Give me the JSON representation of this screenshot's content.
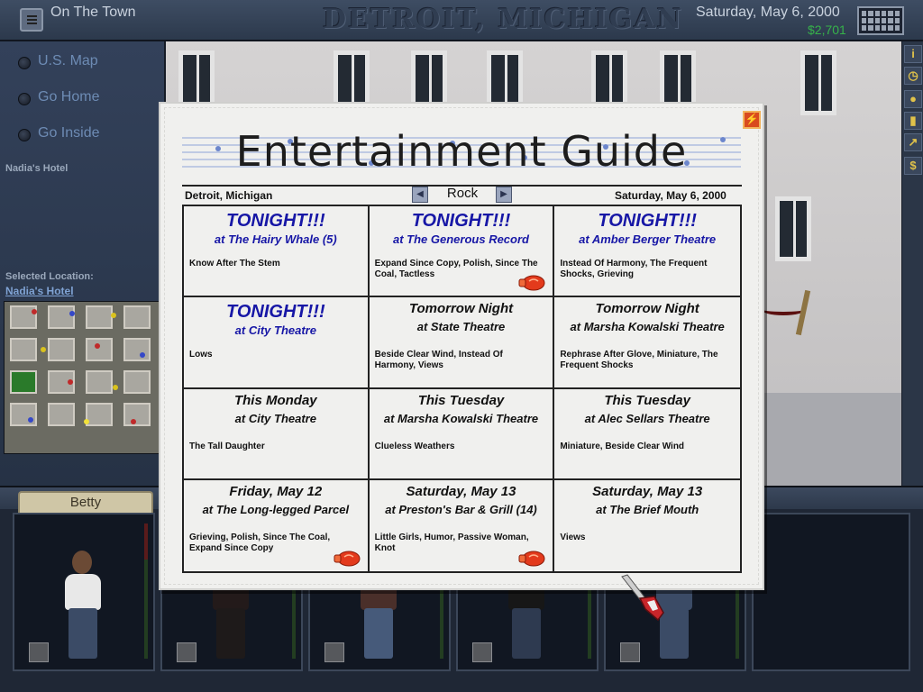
{
  "topbar": {
    "screen_title": "On The Town",
    "city_title": "DETROIT, MICHIGAN",
    "date": "Saturday, May 6, 2000",
    "money": "$2,701"
  },
  "leftnav": {
    "items": [
      {
        "label": "U.S. Map"
      },
      {
        "label": "Go Home"
      },
      {
        "label": "Go Inside"
      }
    ],
    "current_location": "Nadia's Hotel",
    "selected_location_label": "Selected Location:",
    "selected_location": "Nadia's Hotel"
  },
  "band": {
    "member_tab": "Betty"
  },
  "guide": {
    "title": "Entertainment Guide",
    "city": "Detroit, Michigan",
    "genre": "Rock",
    "date": "Saturday, May 6, 2000",
    "close_icon": "close-icon",
    "events": [
      {
        "when": "TONIGHT!!!",
        "where": "at The Hairy Whale (5)",
        "bands": "Know After The Stem",
        "tonight": true,
        "glove": false
      },
      {
        "when": "TONIGHT!!!",
        "where": "at The Generous Record",
        "bands": "Expand Since Copy, Polish, Since The Coal, Tactless",
        "tonight": true,
        "glove": true
      },
      {
        "when": "TONIGHT!!!",
        "where": "at Amber Berger Theatre",
        "bands": "Instead Of Harmony, The Frequent Shocks, Grieving",
        "tonight": true,
        "glove": false
      },
      {
        "when": "TONIGHT!!!",
        "where": "at City Theatre",
        "bands": "Lows",
        "tonight": true,
        "glove": false
      },
      {
        "when": "Tomorrow Night",
        "where": "at State Theatre",
        "bands": "Beside Clear Wind, Instead Of Harmony, Views",
        "tonight": false,
        "glove": false
      },
      {
        "when": "Tomorrow Night",
        "where": "at Marsha Kowalski Theatre",
        "bands": "Rephrase After Glove, Miniature, The Frequent Shocks",
        "tonight": false,
        "glove": false
      },
      {
        "when": "This Monday",
        "where": "at City Theatre",
        "bands": "The Tall Daughter",
        "tonight": false,
        "glove": false
      },
      {
        "when": "This Tuesday",
        "where": "at Marsha Kowalski Theatre",
        "bands": "Clueless Weathers",
        "tonight": false,
        "glove": false
      },
      {
        "when": "This Tuesday",
        "where": "at Alec Sellars Theatre",
        "bands": "Miniature, Beside Clear Wind",
        "tonight": false,
        "glove": false
      },
      {
        "when": "Friday, May 12",
        "where": "at The Long-legged Parcel",
        "bands": "Grieving, Polish, Since The Coal, Expand Since Copy",
        "tonight": false,
        "glove": true
      },
      {
        "when": "Saturday, May 13",
        "where": "at Preston's Bar & Grill (14)",
        "bands": "Little Girls, Humor, Passive Woman, Knot",
        "tonight": false,
        "glove": true
      },
      {
        "when": "Saturday, May 13",
        "where": "at The Brief Mouth",
        "bands": "Views",
        "tonight": false,
        "glove": false
      }
    ]
  },
  "colors": {
    "tonight_blue": "#1717a6",
    "money_green": "#36b24a",
    "nav_blue": "#6d8bb4"
  }
}
